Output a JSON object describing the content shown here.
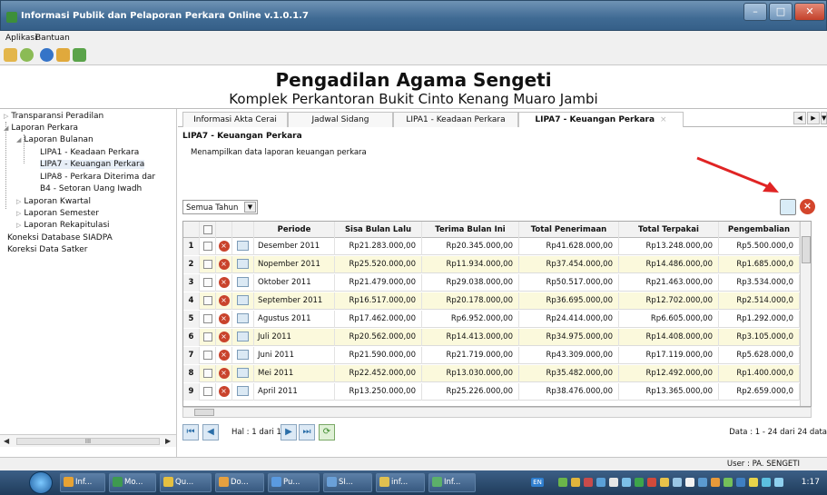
{
  "window": {
    "title": "Informasi Publik dan Pelaporan Perkara Online v.1.0.1.7",
    "colors": {
      "titlebar": "#3f6a93",
      "close": "#c3412a"
    }
  },
  "menu": {
    "items": [
      "Aplikasi",
      "Bantuan"
    ]
  },
  "toolbar": {
    "icons": [
      "home-icon",
      "favorite-icon",
      "help-icon",
      "user-icon",
      "chart-icon"
    ]
  },
  "banner": {
    "title": "Pengadilan Agama Sengeti",
    "subtitle": "Komplek Perkantoran Bukit Cinto Kenang Muaro Jambi"
  },
  "tree": {
    "transparansi": "Transparansi Peradilan",
    "laporan_perkara": "Laporan Perkara",
    "laporan_bulanan": "Laporan Bulanan",
    "lipa1": "LIPA1 - Keadaan Perkara",
    "lipa7": "LIPA7 - Keuangan Perkara",
    "lipa8": "LIPA8 - Perkara Diterima dar",
    "b4": "B4 - Setoran Uang Iwadh",
    "kwartal": "Laporan Kwartal",
    "semester": "Laporan Semester",
    "rekap": "Laporan Rekapitulasi",
    "koneksi_db": "Koneksi Database SIADPA",
    "koneksi_satker": "Koreksi Data Satker",
    "scroll_thumb": "III"
  },
  "tabs": {
    "t1": "Informasi Akta Cerai",
    "t2": "Jadwal Sidang",
    "t3": "LIPA1 - Keadaan Perkara",
    "t4": "LIPA7 - Keuangan Perkara",
    "close": "×"
  },
  "panel": {
    "title": "LIPA7 - Keuangan Perkara",
    "description": "Menampilkan data laporan keuangan perkara",
    "year_filter": "Semua Tahun",
    "annotation_color": "#e02424"
  },
  "grid": {
    "columns": [
      "Periode",
      "Sisa Bulan Lalu",
      "Terima Bulan Ini",
      "Total Penerimaan",
      "Total Terpakai",
      "Pengembalian"
    ],
    "rows": [
      {
        "no": "1",
        "periode": "Desember 2011",
        "sisa": "Rp21.283.000,00",
        "terima": "Rp20.345.000,00",
        "total": "Rp41.628.000,00",
        "terpakai": "Rp13.248.000,00",
        "kembali": "Rp5.500.000,0"
      },
      {
        "no": "2",
        "periode": "Nopember 2011",
        "sisa": "Rp25.520.000,00",
        "terima": "Rp11.934.000,00",
        "total": "Rp37.454.000,00",
        "terpakai": "Rp14.486.000,00",
        "kembali": "Rp1.685.000,0"
      },
      {
        "no": "3",
        "periode": "Oktober 2011",
        "sisa": "Rp21.479.000,00",
        "terima": "Rp29.038.000,00",
        "total": "Rp50.517.000,00",
        "terpakai": "Rp21.463.000,00",
        "kembali": "Rp3.534.000,0"
      },
      {
        "no": "4",
        "periode": "September 2011",
        "sisa": "Rp16.517.000,00",
        "terima": "Rp20.178.000,00",
        "total": "Rp36.695.000,00",
        "terpakai": "Rp12.702.000,00",
        "kembali": "Rp2.514.000,0"
      },
      {
        "no": "5",
        "periode": "Agustus 2011",
        "sisa": "Rp17.462.000,00",
        "terima": "Rp6.952.000,00",
        "total": "Rp24.414.000,00",
        "terpakai": "Rp6.605.000,00",
        "kembali": "Rp1.292.000,0"
      },
      {
        "no": "6",
        "periode": "Juli 2011",
        "sisa": "Rp20.562.000,00",
        "terima": "Rp14.413.000,00",
        "total": "Rp34.975.000,00",
        "terpakai": "Rp14.408.000,00",
        "kembali": "Rp3.105.000,0"
      },
      {
        "no": "7",
        "periode": "Juni 2011",
        "sisa": "Rp21.590.000,00",
        "terima": "Rp21.719.000,00",
        "total": "Rp43.309.000,00",
        "terpakai": "Rp17.119.000,00",
        "kembali": "Rp5.628.000,0"
      },
      {
        "no": "8",
        "periode": "Mei 2011",
        "sisa": "Rp22.452.000,00",
        "terima": "Rp13.030.000,00",
        "total": "Rp35.482.000,00",
        "terpakai": "Rp12.492.000,00",
        "kembali": "Rp1.400.000,0"
      },
      {
        "no": "9",
        "periode": "April 2011",
        "sisa": "Rp13.250.000,00",
        "terima": "Rp25.226.000,00",
        "total": "Rp38.476.000,00",
        "terpakai": "Rp13.365.000,00",
        "kembali": "Rp2.659.000,0"
      }
    ],
    "row_alt_color": "#fbf9dc"
  },
  "pager": {
    "page_text": "Hal : 1 dari 1",
    "info": "Data : 1 - 24 dari 24 data"
  },
  "status": {
    "user": "User : PA. SENGETI"
  },
  "taskbar": {
    "tasks": [
      "Inf...",
      "Mo...",
      "Qu...",
      "Do...",
      "Pu...",
      "SI...",
      "inf...",
      "Inf..."
    ],
    "lang": "EN",
    "clock": "1:17"
  }
}
